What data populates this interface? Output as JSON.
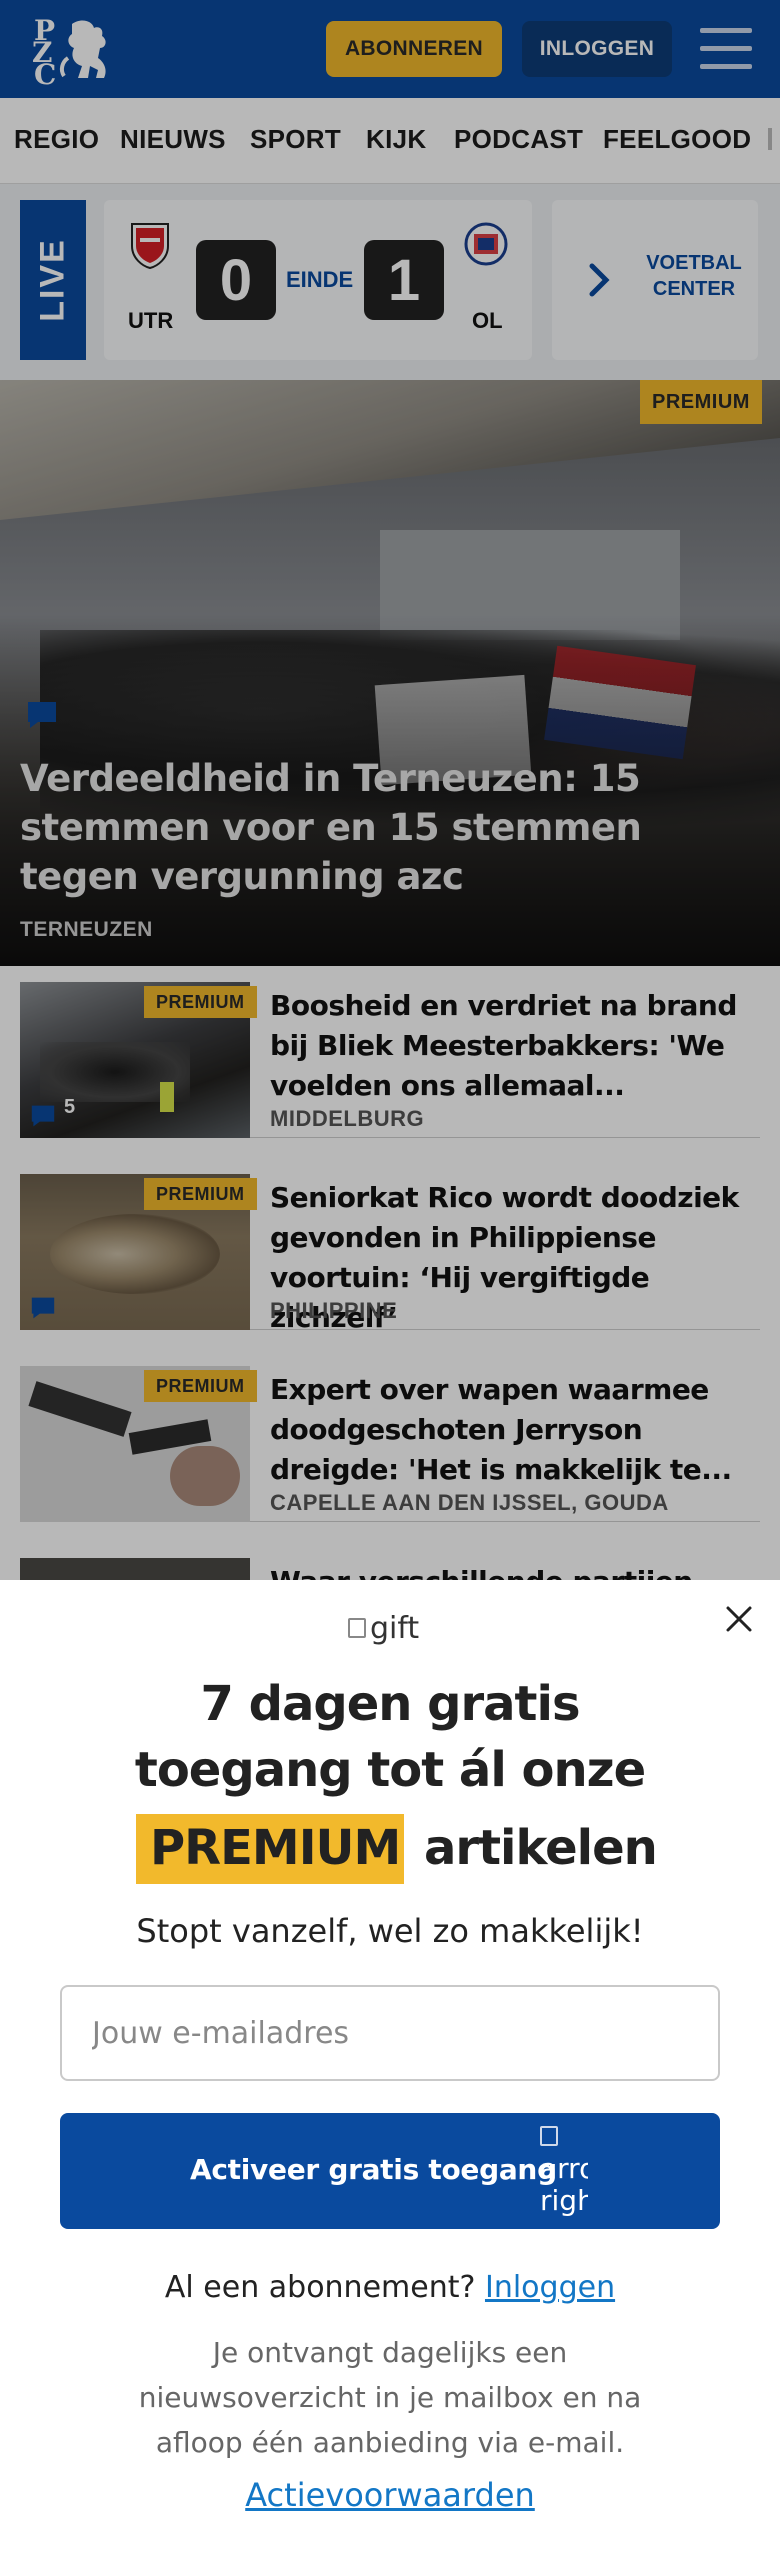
{
  "header": {
    "logo_letters": [
      "P",
      "Z",
      "C"
    ],
    "subscribe_label": "ABONNEREN",
    "login_label": "INLOGGEN",
    "colors": {
      "brand": "#0a4a9e",
      "accent": "#f2b92c"
    }
  },
  "nav": {
    "items": [
      "REGIO",
      "NIEUWS",
      "SPORT",
      "KIJK",
      "PODCAST",
      "FEELGOOD"
    ]
  },
  "live": {
    "label": "LIVE",
    "home_team": "UTR",
    "home_score": "0",
    "status": "EINDE",
    "away_score": "1",
    "away_team": "OL",
    "center_label_line1": "VOETBAL",
    "center_label_line2": "CENTER"
  },
  "hero": {
    "badge": "PREMIUM",
    "title": "Verdeeldheid in Terneuzen: 15 stemmen voor en 15 stemmen tegen vergunning azc",
    "location": "TERNEUZEN"
  },
  "articles": [
    {
      "badge": "PREMIUM",
      "title": "Boosheid en verdriet na brand bij Bliek Meesterbakkers: 'We voelden ons allemaal...",
      "location": "MIDDELBURG",
      "comments": "5"
    },
    {
      "badge": "PREMIUM",
      "title": "Seniorkat Rico wordt doodziek gevonden in Philippiense voortuin: ‘Hij vergiftigde zichzelf’",
      "location": "PHILIPPINE",
      "comments": ""
    },
    {
      "badge": "PREMIUM",
      "title": "Expert over wapen waarmee doodgeschoten Jerryson dreigde: 'Het is makkelijk te...",
      "location": "CAPELLE AAN DEN IJSSEL, GOUDA",
      "comments": ""
    },
    {
      "title": "Waar verschillende partijen"
    }
  ],
  "modal": {
    "gift_alt": "gift",
    "title_line1": "7 dagen gratis",
    "title_line2": "toegang tot ál onze",
    "premium_word": "PREMIUM",
    "title_line3_rest": "artikelen",
    "subtitle": "Stopt vanzelf, wel zo makkelijk!",
    "email_placeholder": "Jouw e-mailadres",
    "activate_label": "Activeer gratis toegang",
    "arrow_alt": "arrow-right",
    "already_text": "Al een abonnement?",
    "already_link": "Inloggen",
    "info": "Je ontvangt dagelijks een nieuwsoverzicht in je mailbox en na afloop één aanbieding via e-mail.",
    "terms": "Actievoorwaarden"
  }
}
